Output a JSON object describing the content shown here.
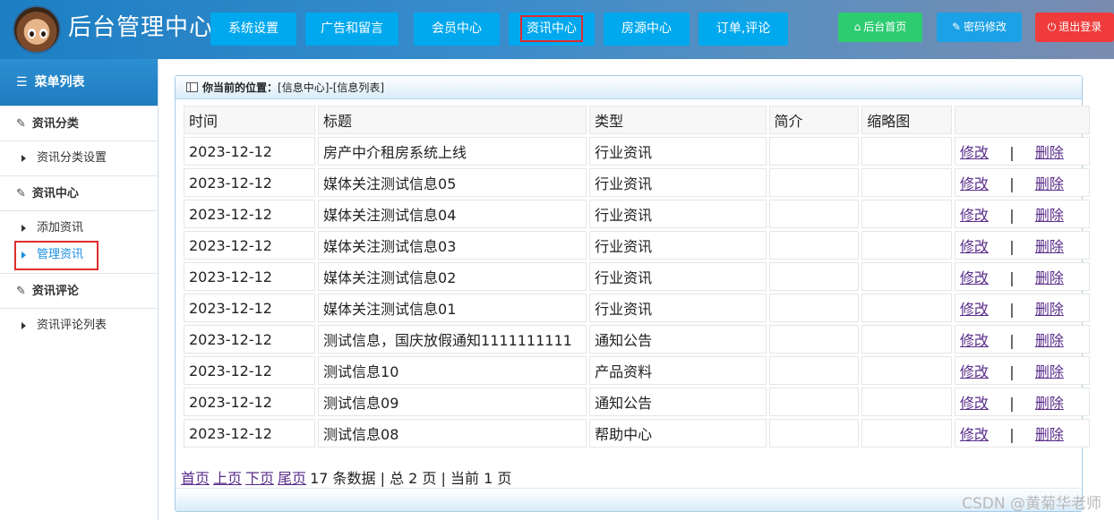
{
  "app": {
    "title": "后台管理中心"
  },
  "nav": {
    "items": [
      {
        "label": "系统设置"
      },
      {
        "label": "广告和留言"
      },
      {
        "label": "会员中心"
      },
      {
        "label": "资讯中心"
      },
      {
        "label": "房源中心"
      },
      {
        "label": "订单,评论"
      }
    ],
    "active": "资讯中心"
  },
  "top_actions": {
    "home": {
      "label": "后台首页",
      "icon": "home-icon",
      "color": "#2ecc71"
    },
    "password": {
      "label": "密码修改",
      "icon": "wrench-icon",
      "color": "#1aa1e6"
    },
    "logout": {
      "label": "退出登录",
      "icon": "power-icon",
      "color": "#ef3b3b"
    }
  },
  "sidebar": {
    "header": "菜单列表",
    "groups": [
      {
        "title": "资讯分类",
        "items": [
          "资讯分类设置"
        ]
      },
      {
        "title": "资讯中心",
        "items": [
          "添加资讯",
          "管理资讯"
        ]
      },
      {
        "title": "资讯评论",
        "items": [
          "资讯评论列表"
        ]
      }
    ],
    "active_item": "管理资讯"
  },
  "breadcrumb": {
    "prefix": "你当前的位置：",
    "path": "[信息中心]-[信息列表]"
  },
  "table": {
    "headers": [
      "时间",
      "标题",
      "类型",
      "简介",
      "缩略图",
      ""
    ],
    "rows": [
      {
        "time": "2023-12-12",
        "title": "房产中介租房系统上线",
        "type": "行业资讯",
        "intro": "",
        "thumb": ""
      },
      {
        "time": "2023-12-12",
        "title": "媒体关注测试信息05",
        "type": "行业资讯",
        "intro": "",
        "thumb": ""
      },
      {
        "time": "2023-12-12",
        "title": "媒体关注测试信息04",
        "type": "行业资讯",
        "intro": "",
        "thumb": ""
      },
      {
        "time": "2023-12-12",
        "title": "媒体关注测试信息03",
        "type": "行业资讯",
        "intro": "",
        "thumb": ""
      },
      {
        "time": "2023-12-12",
        "title": "媒体关注测试信息02",
        "type": "行业资讯",
        "intro": "",
        "thumb": ""
      },
      {
        "time": "2023-12-12",
        "title": "媒体关注测试信息01",
        "type": "行业资讯",
        "intro": "",
        "thumb": ""
      },
      {
        "time": "2023-12-12",
        "title": "测试信息，国庆放假通知1111111111",
        "type": "通知公告",
        "intro": "",
        "thumb": ""
      },
      {
        "time": "2023-12-12",
        "title": "测试信息10",
        "type": "产品资料",
        "intro": "",
        "thumb": ""
      },
      {
        "time": "2023-12-12",
        "title": "测试信息09",
        "type": "通知公告",
        "intro": "",
        "thumb": ""
      },
      {
        "time": "2023-12-12",
        "title": "测试信息08",
        "type": "帮助中心",
        "intro": "",
        "thumb": ""
      }
    ],
    "edit_label": "修改",
    "separator": "|",
    "delete_label": "删除"
  },
  "pager": {
    "first": "首页",
    "prev": "上页",
    "next": "下页",
    "last": "尾页",
    "summary": "17 条数据 | 总 2 页 | 当前 1 页"
  },
  "watermark": "CSDN @黄菊华老师"
}
